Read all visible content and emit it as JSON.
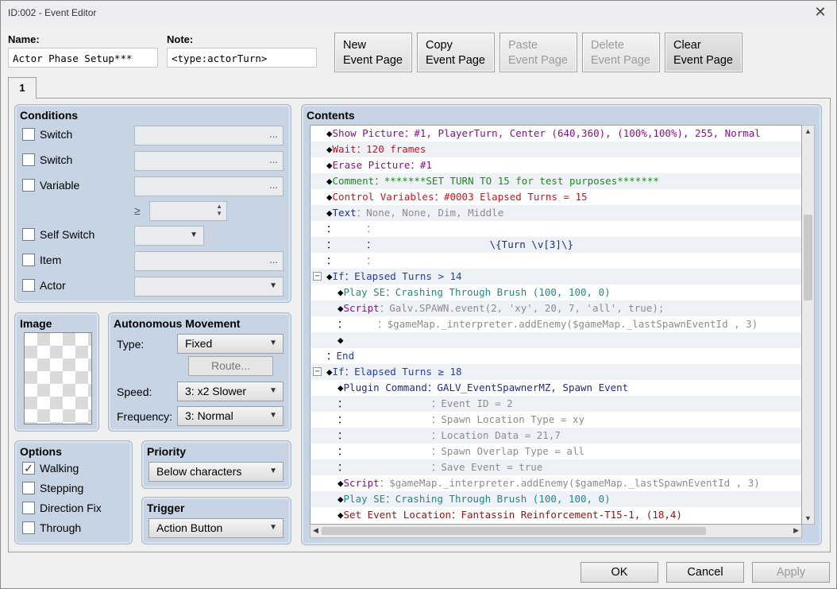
{
  "window": {
    "title": "ID:002 - Event Editor",
    "close_glyph": "✕"
  },
  "header": {
    "name_label": "Name:",
    "name_value": "Actor Phase Setup***",
    "note_label": "Note:",
    "note_value": "<type:actorTurn>"
  },
  "page_buttons": [
    {
      "line1": "New",
      "line2": "Event Page"
    },
    {
      "line1": "Copy",
      "line2": "Event Page"
    },
    {
      "line1": "Paste",
      "line2": "Event Page"
    },
    {
      "line1": "Delete",
      "line2": "Event Page"
    },
    {
      "line1": "Clear",
      "line2": "Event Page"
    }
  ],
  "tab": {
    "label": "1"
  },
  "conditions": {
    "title": "Conditions",
    "switch1": "Switch",
    "switch2": "Switch",
    "variable": "Variable",
    "gte": "≥",
    "self_switch": "Self Switch",
    "item": "Item",
    "actor": "Actor",
    "dots": "..."
  },
  "image": {
    "title": "Image"
  },
  "movement": {
    "title": "Autonomous Movement",
    "type_label": "Type:",
    "type_value": "Fixed",
    "route_label": "Route...",
    "speed_label": "Speed:",
    "speed_value": "3: x2 Slower",
    "freq_label": "Frequency:",
    "freq_value": "3: Normal"
  },
  "options": {
    "title": "Options",
    "walking": "Walking",
    "walking_checked": true,
    "stepping": "Stepping",
    "direction_fix": "Direction Fix",
    "through": "Through",
    "check_mark": "✓"
  },
  "priority": {
    "title": "Priority",
    "value": "Below characters"
  },
  "trigger": {
    "title": "Trigger",
    "value": "Action Button"
  },
  "contents": {
    "title": "Contents",
    "rows": [
      {
        "p": "◆",
        "indent": 1,
        "segs": [
          [
            "Show Picture",
            "pur"
          ],
          [
            "：#1, PlayerTurn, Center (640,360), (100%,100%), 255, Normal",
            "pur"
          ]
        ]
      },
      {
        "p": "◆",
        "indent": 1,
        "segs": [
          [
            "Wait",
            "red"
          ],
          [
            "：120 frames",
            "red"
          ]
        ]
      },
      {
        "p": "◆",
        "indent": 1,
        "segs": [
          [
            "Erase Picture",
            "pur"
          ],
          [
            "：#1",
            "pur"
          ]
        ]
      },
      {
        "p": "◆",
        "indent": 1,
        "segs": [
          [
            "Comment",
            "grn"
          ],
          [
            "：*******SET TURN TO 15 for test purposes*******",
            "grn"
          ]
        ]
      },
      {
        "p": "◆",
        "indent": 1,
        "segs": [
          [
            "Control Variables",
            "red"
          ],
          [
            "：#0003 Elapsed Turns = 15",
            "red"
          ]
        ]
      },
      {
        "p": "◆",
        "indent": 1,
        "segs": [
          [
            "Text",
            "nvy"
          ],
          [
            "：None, None, Dim, Middle",
            "gry"
          ]
        ]
      },
      {
        "p": "：",
        "indent": 1,
        "segs": [
          [
            "     ：",
            "gry"
          ]
        ]
      },
      {
        "p": "：",
        "indent": 1,
        "segs": [
          [
            "     ：                   \\{Turn \\v[3]\\}",
            "nvy"
          ]
        ]
      },
      {
        "p": "：",
        "indent": 1,
        "segs": [
          [
            "     ：",
            "gry"
          ]
        ]
      },
      {
        "p": "◆",
        "indent": 1,
        "fold": "−",
        "segs": [
          [
            "If",
            "blu"
          ],
          [
            "：Elapsed Turns > 14",
            "blu"
          ]
        ]
      },
      {
        "p": "◆",
        "indent": 2,
        "segs": [
          [
            "Play SE",
            "tea"
          ],
          [
            "：Crashing Through Brush (100, 100, 0)",
            "tea"
          ]
        ]
      },
      {
        "p": "◆",
        "indent": 2,
        "segs": [
          [
            "Script",
            "pur"
          ],
          [
            "：Galv.SPAWN.event(2, 'xy', 20, 7, 'all', true);",
            "gry"
          ]
        ]
      },
      {
        "p": "：",
        "indent": 2,
        "segs": [
          [
            "     ：$gameMap._interpreter.addEnemy($gameMap._lastSpawnEventId , 3)",
            "gry"
          ]
        ]
      },
      {
        "p": "◆",
        "indent": 2,
        "segs": []
      },
      {
        "p": "：",
        "indent": 1,
        "segs": [
          [
            "End",
            "blu"
          ]
        ]
      },
      {
        "p": "◆",
        "indent": 1,
        "fold": "−",
        "segs": [
          [
            "If",
            "blu"
          ],
          [
            "：Elapsed Turns ≥ 18",
            "blu"
          ]
        ]
      },
      {
        "p": "◆",
        "indent": 2,
        "segs": [
          [
            "Plugin Command",
            "nvy"
          ],
          [
            "：GALV_EventSpawnerMZ, Spawn Event",
            "nvy"
          ]
        ]
      },
      {
        "p": "：",
        "indent": 2,
        "segs": [
          [
            "              ：Event ID = 2",
            "gry"
          ]
        ]
      },
      {
        "p": "：",
        "indent": 2,
        "segs": [
          [
            "              ：Spawn Location Type = xy",
            "gry"
          ]
        ]
      },
      {
        "p": "：",
        "indent": 2,
        "segs": [
          [
            "              ：Location Data = 21,7",
            "gry"
          ]
        ]
      },
      {
        "p": "：",
        "indent": 2,
        "segs": [
          [
            "              ：Spawn Overlap Type = all",
            "gry"
          ]
        ]
      },
      {
        "p": "：",
        "indent": 2,
        "segs": [
          [
            "              ：Save Event = true",
            "gry"
          ]
        ]
      },
      {
        "p": "◆",
        "indent": 2,
        "segs": [
          [
            "Script",
            "pur"
          ],
          [
            "：$gameMap._interpreter.addEnemy($gameMap._lastSpawnEventId , 3)",
            "gry"
          ]
        ]
      },
      {
        "p": "◆",
        "indent": 2,
        "segs": [
          [
            "Play SE",
            "tea"
          ],
          [
            "：Crashing Through Brush (100, 100, 0)",
            "tea"
          ]
        ]
      },
      {
        "p": "◆",
        "indent": 2,
        "segs": [
          [
            "Set Event Location",
            "dred"
          ],
          [
            "：Fantassin Reinforcement-T15-1, (18,4)",
            "dred"
          ]
        ]
      }
    ]
  },
  "footer": {
    "ok": "OK",
    "cancel": "Cancel",
    "apply": "Apply"
  }
}
